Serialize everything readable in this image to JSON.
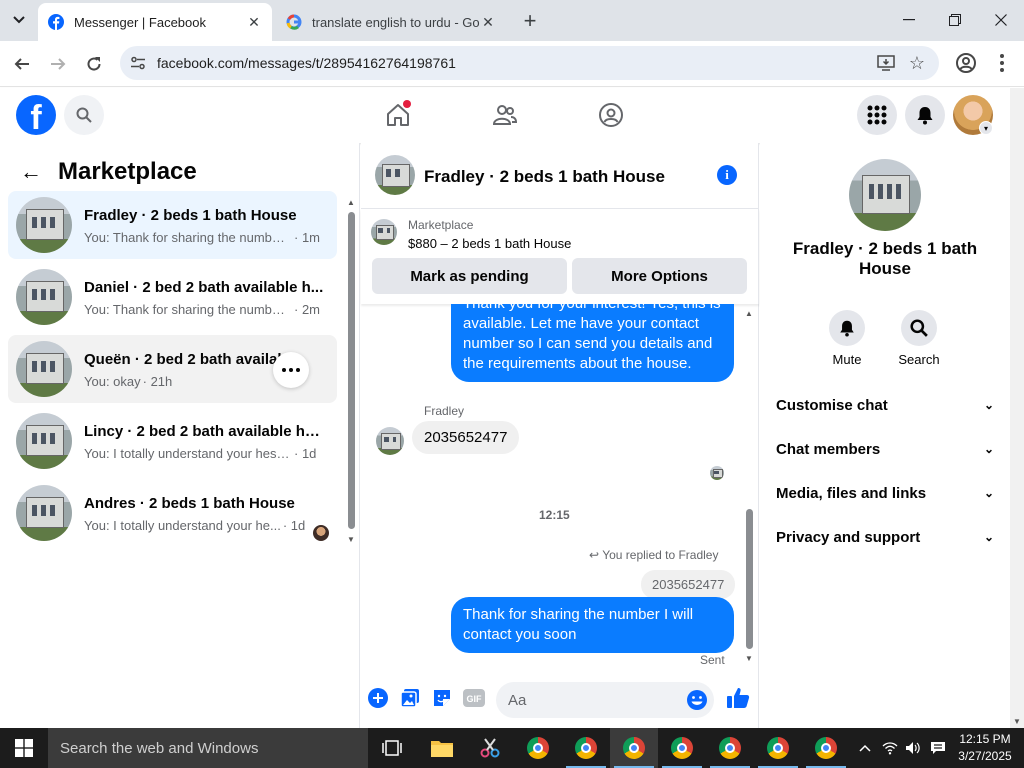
{
  "browser": {
    "tabs": [
      {
        "title": "Messenger | Facebook",
        "active": true
      },
      {
        "title": "translate english to urdu - Goo",
        "active": false
      }
    ],
    "url": "facebook.com/messages/t/28954162764198761"
  },
  "left_panel": {
    "title": "Marketplace",
    "conversations": [
      {
        "name": "Fradley · 2 beds 1 bath House",
        "preview": "You: Thank for sharing the number...",
        "time": "· 1m",
        "state": "active"
      },
      {
        "name": "Daniel · 2 bed 2 bath available h...",
        "preview": "You: Thank for sharing the number...",
        "time": "· 2m",
        "state": "normal"
      },
      {
        "name": "Queën · 2 bed 2 bath availab...",
        "preview": "You: okay",
        "time": "· 21h",
        "state": "hover"
      },
      {
        "name": "Lincy · 2 bed 2 bath available ho...",
        "preview": "You: I totally understand your hesit...",
        "time": "· 1d",
        "state": "normal"
      },
      {
        "name": "Andres · 2 beds 1 bath House",
        "preview": "You: I totally understand your he...",
        "time": "· 1d",
        "state": "normal"
      }
    ]
  },
  "chat": {
    "title": "Fradley · 2 beds 1 bath House",
    "info_glyph": "i",
    "marketplace_label": "Marketplace",
    "listing": "$880 – 2 beds 1 bath House",
    "mark_pending": "Mark as pending",
    "more_options": "More Options",
    "messages": {
      "outgoing_1": "Thank you for your interest! Yes, this is available. Let me have your contact number so I can send you details and the requirements about the house.",
      "sender": "Fradley",
      "incoming_1": "2035652477",
      "timestamp": "12:15",
      "reply_note": "You replied to Fradley",
      "quoted": "2035652477",
      "outgoing_2": "Thank for sharing  the number I will contact you soon",
      "status": "Sent"
    },
    "composer_placeholder": "Aa"
  },
  "right_panel": {
    "title": "Fradley · 2 beds 1 bath House",
    "actions": [
      {
        "label": "Mute",
        "icon": "bell-icon"
      },
      {
        "label": "Search",
        "icon": "search-icon"
      }
    ],
    "sections": [
      "Customise chat",
      "Chat members",
      "Media, files and links",
      "Privacy and support"
    ]
  },
  "taskbar": {
    "search_placeholder": "Search the web and Windows",
    "time": "12:15 PM",
    "date": "3/27/2025"
  },
  "colors": {
    "fb_blue": "#0866ff",
    "bubble_blue": "#0a7cff",
    "active_conv": "#ebf5ff"
  }
}
